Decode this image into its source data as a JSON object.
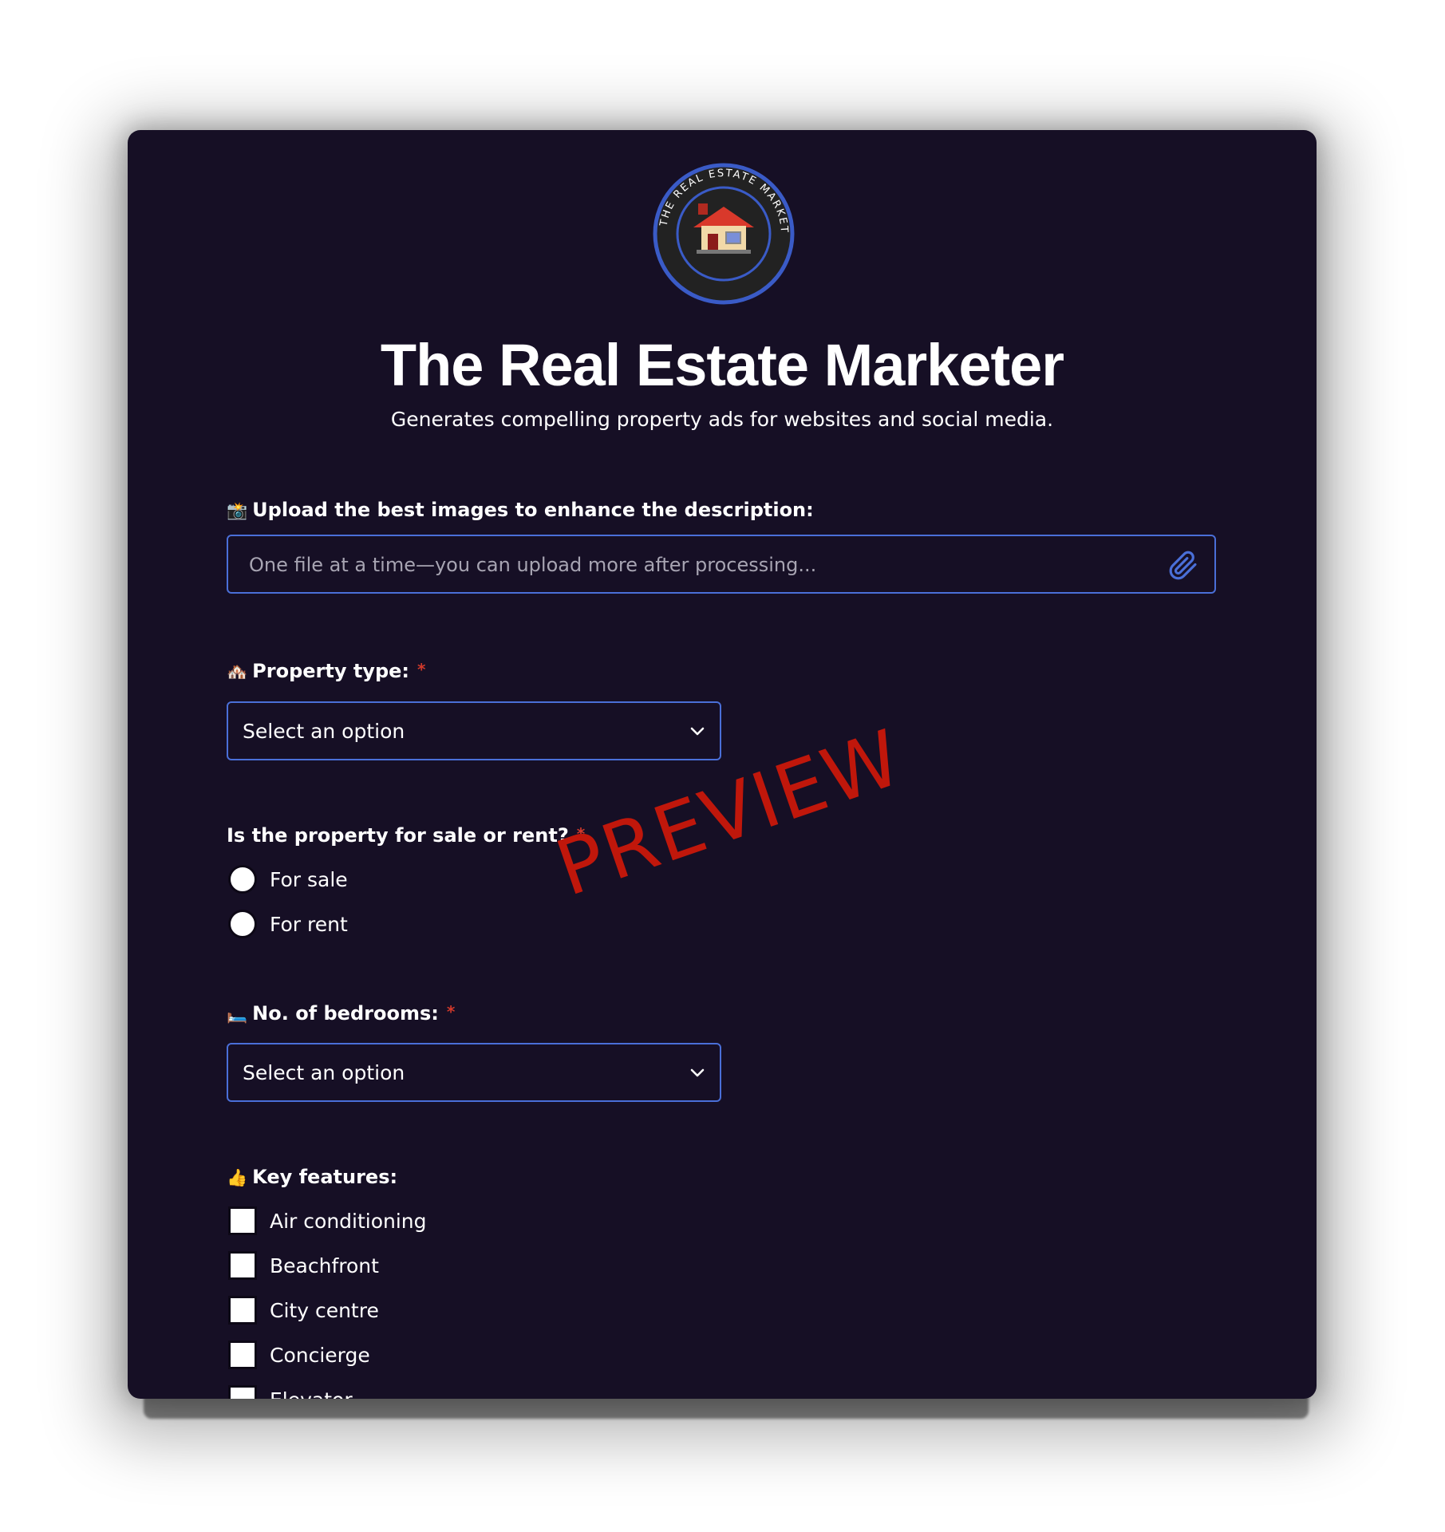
{
  "app": {
    "title": "The Real Estate Marketer",
    "subtitle": "Generates compelling property ads for websites and social media.",
    "logo": {
      "ring_text": "THE REAL ESTATE MARKETER",
      "icon": "house-icon",
      "ring_color": "#3a5bc7"
    },
    "watermark": "PREVIEW"
  },
  "form": {
    "upload": {
      "emoji": "📸",
      "label": "Upload the best images to enhance the description:",
      "placeholder": "One file at a time—you can upload more after processing...",
      "icon": "paperclip-icon"
    },
    "property_type": {
      "emoji": "🏘️",
      "label": "Property type:",
      "required_mark": "*",
      "selected": "Select an option"
    },
    "sale_or_rent": {
      "label": "Is the property for sale or rent?",
      "required_mark": "*",
      "options": [
        "For sale",
        "For rent"
      ]
    },
    "bedrooms": {
      "emoji": "🛏️",
      "label": "No. of bedrooms:",
      "required_mark": "*",
      "selected": "Select an option"
    },
    "key_features": {
      "emoji": "👍",
      "label": "Key features:",
      "options": [
        "Air conditioning",
        "Beachfront",
        "City centre",
        "Concierge",
        "Elevator"
      ]
    }
  },
  "colors": {
    "background": "#160f25",
    "accent": "#4a6fd8",
    "required": "#d0392b",
    "watermark": "#c0170b"
  }
}
